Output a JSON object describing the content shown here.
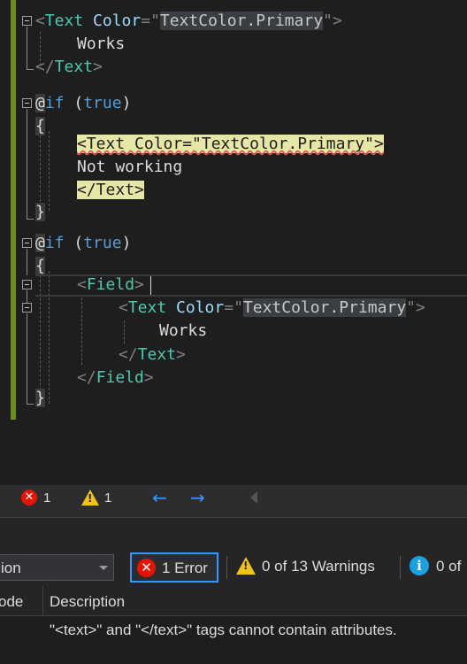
{
  "editor": {
    "block1": {
      "open_lt": "<",
      "tag": "Text",
      "attr": "Color",
      "eq_q": "=\"",
      "value": "TextColor.Primary",
      "q_gt": "\">",
      "content": "Works",
      "close_lt": "</",
      "close_tag": "Text",
      "close_gt": ">"
    },
    "block2": {
      "at": "@",
      "kw": "if",
      "open_paren": " (",
      "cond": "true",
      "close_paren": ")",
      "open_brace": "{",
      "line1": "<Text Color=\"TextColor.Primary\">",
      "line2": "Not working",
      "line3": "</Text>",
      "close_brace": "}"
    },
    "block3": {
      "at": "@",
      "kw": "if",
      "open_paren": " (",
      "cond": "true",
      "close_paren": ")",
      "open_brace": "{",
      "field_lt": "<",
      "field_tag": "Field",
      "field_gt": ">",
      "text_lt": "<",
      "text_tag": "Text",
      "attr": "Color",
      "eq_q": "=\"",
      "value": "TextColor.Primary",
      "q_gt": "\">",
      "content": "Works",
      "text_close_lt": "</",
      "text_close_tag": "Text",
      "text_close_gt": ">",
      "field_close_lt": "</",
      "field_close_tag": "Field",
      "field_close_gt": ">",
      "close_brace": "}"
    }
  },
  "status": {
    "error_count": "1",
    "warning_count": "1",
    "icons": [
      "error-icon",
      "warning-icon",
      "arrow-left-icon",
      "arrow-right-icon"
    ]
  },
  "error_list": {
    "scope_label": "ion",
    "errors_label": "1 Error",
    "error_icon_glyph": "✕",
    "warnings_label": "0 of 13 Warnings",
    "messages_label": "0 of",
    "info_glyph": "i",
    "columns": [
      "ode",
      "Description"
    ],
    "rows": [
      {
        "description": "\"<text>\" and \"</text>\" tags cannot contain attributes."
      }
    ]
  },
  "colors": {
    "change_bar": "#6b8e23",
    "tag": "#4ec9b0",
    "attribute": "#9cdcfe",
    "keyword": "#569cd6",
    "highlight": "#e6e6a7",
    "error": "#e51400",
    "warning": "#f0c419",
    "accent": "#3794ff"
  }
}
